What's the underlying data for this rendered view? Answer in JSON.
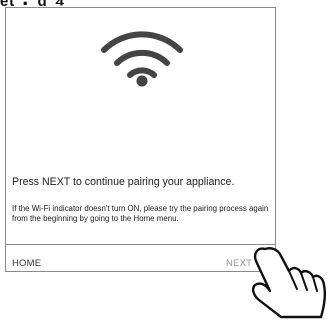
{
  "page_header_fragment": "ᵉᵗ · ᵈ ⁴",
  "screen": {
    "main_message": "Press NEXT to continue pairing your appliance.",
    "help_text": "If the Wi-Fi indicator doesn't turn ON, please try the pairing process again from the beginning by going to the Home menu.",
    "footer": {
      "home_label": "HOME",
      "next_label": "NEXT"
    },
    "icons": {
      "status_icon": "wifi-icon",
      "pointer_icon": "hand-cursor-icon"
    }
  },
  "colors": {
    "border": "#8a8a8a",
    "text": "#222222",
    "next_label": "#9a9a9a",
    "icon": "#444444"
  }
}
